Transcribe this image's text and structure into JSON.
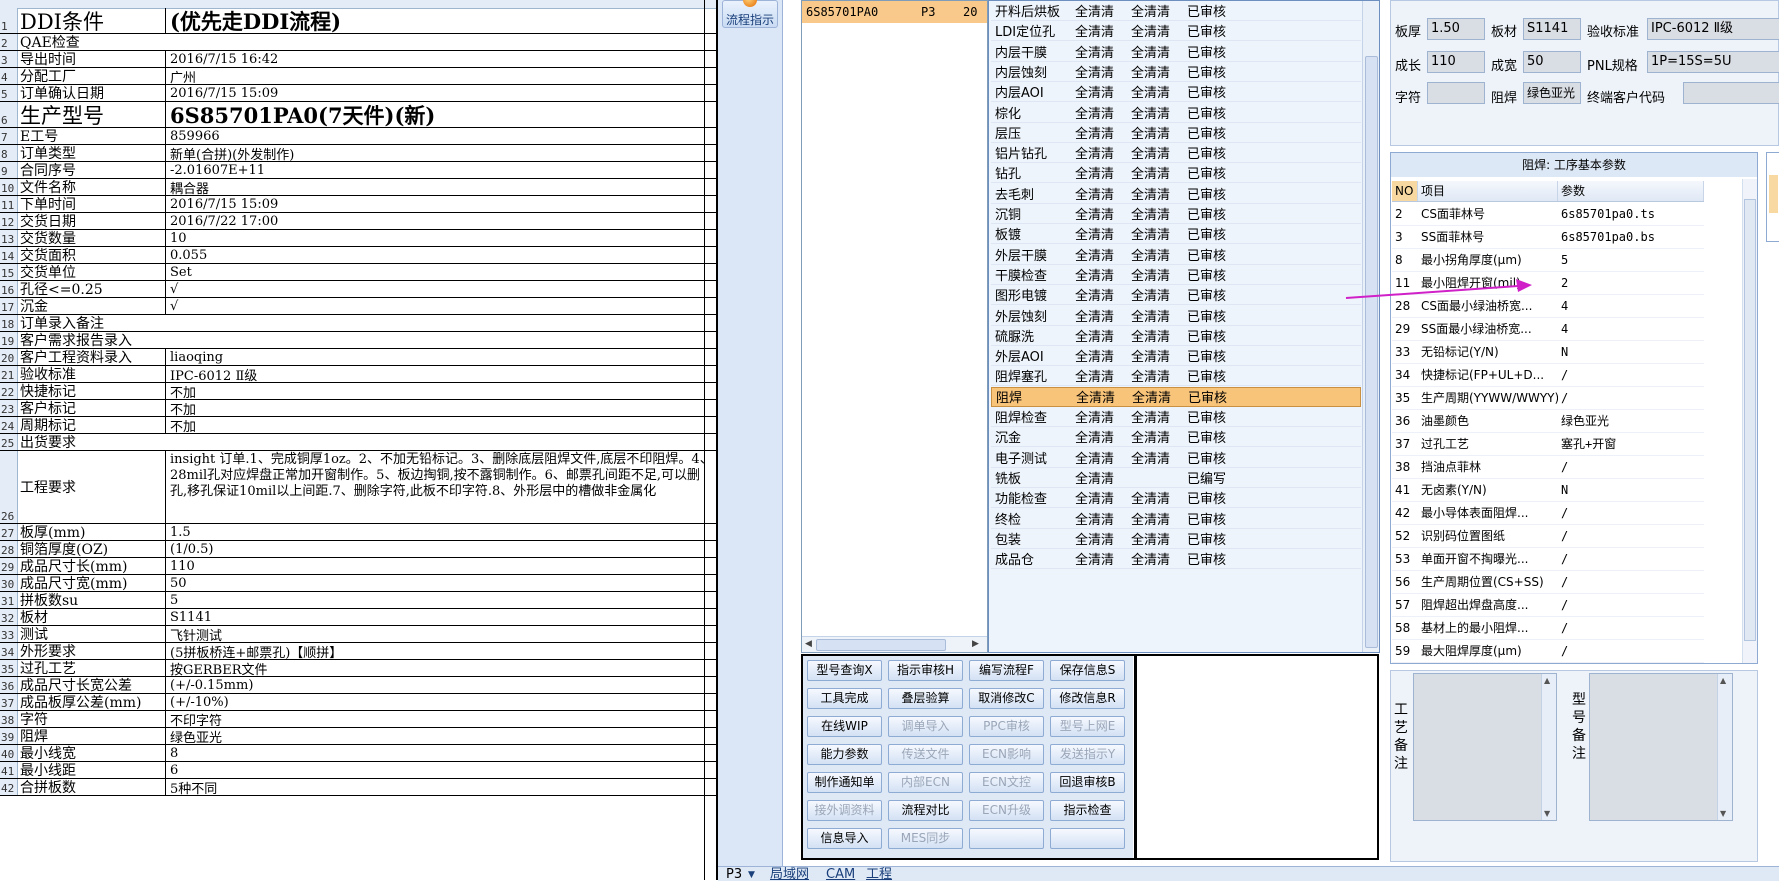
{
  "sheet": {
    "rows": [
      {
        "n": "1",
        "a": "DDI条件",
        "b": "(优先走DDI流程)",
        "big": true
      },
      {
        "n": "2",
        "ab": "QAE检查"
      },
      {
        "n": "3",
        "a": "导出时间",
        "b": "2016/7/15 16:42"
      },
      {
        "n": "4",
        "a": "分配工厂",
        "b": "广州"
      },
      {
        "n": "5",
        "a": "订单确认日期",
        "b": "2016/7/15 15:09"
      },
      {
        "n": "6",
        "a": "生产型号",
        "b": "6S85701PA0(7天件)(新)",
        "big": true
      },
      {
        "n": "7",
        "a": "E工号",
        "b": "859966"
      },
      {
        "n": "8",
        "a": "订单类型",
        "b": "新单(合拼)(外发制作)"
      },
      {
        "n": "9",
        "a": "合同序号",
        "b": "-2.01607E+11"
      },
      {
        "n": "10",
        "a": "文件名称",
        "b": "耦合器"
      },
      {
        "n": "11",
        "a": "下单时间",
        "b": "2016/7/15 15:09"
      },
      {
        "n": "12",
        "a": "交货日期",
        "b": "2016/7/22 17:00"
      },
      {
        "n": "13",
        "a": "交货数量",
        "b": "10"
      },
      {
        "n": "14",
        "a": "交货面积",
        "b": "0.055"
      },
      {
        "n": "15",
        "a": "交货单位",
        "b": "Set"
      },
      {
        "n": "16",
        "a": "孔径<=0.25",
        "b": "√"
      },
      {
        "n": "17",
        "a": "沉金",
        "b": "√"
      },
      {
        "n": "18",
        "ab": "订单录入备注"
      },
      {
        "n": "19",
        "ab": "客户需求报告录入"
      },
      {
        "n": "20",
        "a": "客户工程资料录入",
        "b": "liaoqing"
      },
      {
        "n": "21",
        "a": "验收标准",
        "b": "IPC-6012 Ⅱ级"
      },
      {
        "n": "22",
        "a": "快捷标记",
        "b": "不加"
      },
      {
        "n": "23",
        "a": "客户标记",
        "b": "不加"
      },
      {
        "n": "24",
        "a": "周期标记",
        "b": "不加"
      },
      {
        "n": "25",
        "ab": "出货要求"
      },
      {
        "n": "26",
        "a": "工程要求",
        "b": "insight 订单.1、完成铜厚1oz。2、不加无铅标记。3、删除底层阻焊文件,底层不印阻焊。4、28mil孔对应焊盘正常加开窗制作。5、板边掏铜,按不露铜制作。6、邮票孔间距不足,可以删孔,移孔保证10mil以上间距.7、删除字符,此板不印字符.8、外形层中的槽做非金属化",
        "wrap": true
      },
      {
        "n": "27",
        "a": "板厚(mm)",
        "b": "1.5"
      },
      {
        "n": "28",
        "a": "铜箔厚度(OZ)",
        "b": "(1/0.5)"
      },
      {
        "n": "29",
        "a": "成品尺寸长(mm)",
        "b": "110"
      },
      {
        "n": "30",
        "a": "成品尺寸宽(mm)",
        "b": "50"
      },
      {
        "n": "31",
        "a": "拼板数su",
        "b": "5"
      },
      {
        "n": "32",
        "a": "板材",
        "b": "S1141"
      },
      {
        "n": "33",
        "a": "测试",
        "b": "飞针测试"
      },
      {
        "n": "34",
        "a": "外形要求",
        "b": "(5拼板桥连+邮票孔)【顺拼】"
      },
      {
        "n": "35",
        "a": "过孔工艺",
        "b": "按GERBER文件"
      },
      {
        "n": "36",
        "a": "成品尺寸长宽公差",
        "b": "(+/-0.15mm)"
      },
      {
        "n": "37",
        "a": "成品板厚公差(mm)",
        "b": "(+/-10%)"
      },
      {
        "n": "38",
        "a": "字符",
        "b": "不印字符"
      },
      {
        "n": "39",
        "a": "阻焊",
        "b": "绿色亚光"
      },
      {
        "n": "40",
        "a": "最小线宽",
        "b": "8"
      },
      {
        "n": "41",
        "a": "最小线距",
        "b": "6"
      },
      {
        "n": "42",
        "a": "合拼板数",
        "b": "5种不同"
      }
    ]
  },
  "strip": {
    "flow_button": "流程指示"
  },
  "model_list": {
    "item": {
      "model": "6S85701PA0",
      "code": "P3",
      "num": "20"
    }
  },
  "process_table": {
    "rows": [
      {
        "name": "开料后烘板",
        "c1": "全清清",
        "c2": "全清清",
        "c3": "已审核"
      },
      {
        "name": "LDI定位孔",
        "c1": "全清清",
        "c2": "全清清",
        "c3": "已审核"
      },
      {
        "name": "内层干膜",
        "c1": "全清清",
        "c2": "全清清",
        "c3": "已审核"
      },
      {
        "name": "内层蚀刻",
        "c1": "全清清",
        "c2": "全清清",
        "c3": "已审核"
      },
      {
        "name": "内层AOI",
        "c1": "全清清",
        "c2": "全清清",
        "c3": "已审核"
      },
      {
        "name": "棕化",
        "c1": "全清清",
        "c2": "全清清",
        "c3": "已审核"
      },
      {
        "name": "层压",
        "c1": "全清清",
        "c2": "全清清",
        "c3": "已审核"
      },
      {
        "name": "铝片钻孔",
        "c1": "全清清",
        "c2": "全清清",
        "c3": "已审核"
      },
      {
        "name": "钻孔",
        "c1": "全清清",
        "c2": "全清清",
        "c3": "已审核"
      },
      {
        "name": "去毛刺",
        "c1": "全清清",
        "c2": "全清清",
        "c3": "已审核"
      },
      {
        "name": "沉铜",
        "c1": "全清清",
        "c2": "全清清",
        "c3": "已审核"
      },
      {
        "name": "板镀",
        "c1": "全清清",
        "c2": "全清清",
        "c3": "已审核"
      },
      {
        "name": "外层干膜",
        "c1": "全清清",
        "c2": "全清清",
        "c3": "已审核"
      },
      {
        "name": "干膜检查",
        "c1": "全清清",
        "c2": "全清清",
        "c3": "已审核"
      },
      {
        "name": "图形电镀",
        "c1": "全清清",
        "c2": "全清清",
        "c3": "已审核"
      },
      {
        "name": "外层蚀刻",
        "c1": "全清清",
        "c2": "全清清",
        "c3": "已审核"
      },
      {
        "name": "硫脲洗",
        "c1": "全清清",
        "c2": "全清清",
        "c3": "已审核"
      },
      {
        "name": "外层AOI",
        "c1": "全清清",
        "c2": "全清清",
        "c3": "已审核"
      },
      {
        "name": "阻焊塞孔",
        "c1": "全清清",
        "c2": "全清清",
        "c3": "已审核"
      },
      {
        "name": "阻焊",
        "c1": "全清清",
        "c2": "全清清",
        "c3": "已审核",
        "sel": true
      },
      {
        "name": "阻焊检查",
        "c1": "全清清",
        "c2": "全清清",
        "c3": "已审核"
      },
      {
        "name": "沉金",
        "c1": "全清清",
        "c2": "全清清",
        "c3": "已审核"
      },
      {
        "name": "电子测试",
        "c1": "全清清",
        "c2": "全清清",
        "c3": "已审核"
      },
      {
        "name": "铣板",
        "c1": "全清清",
        "c2": "",
        "c3": "已编写"
      },
      {
        "name": "功能检查",
        "c1": "全清清",
        "c2": "全清清",
        "c3": "已审核"
      },
      {
        "name": "终检",
        "c1": "全清清",
        "c2": "全清清",
        "c3": "已审核"
      },
      {
        "name": "包装",
        "c1": "全清清",
        "c2": "全清清",
        "c3": "已审核"
      },
      {
        "name": "成品仓",
        "c1": "全清清",
        "c2": "全清清",
        "c3": "已审核"
      }
    ]
  },
  "buttons": [
    {
      "label": "型号查询Ⅹ",
      "dis": false
    },
    {
      "label": "指示审核H",
      "dis": false
    },
    {
      "label": "编写流程F",
      "dis": false
    },
    {
      "label": "保存信息S",
      "dis": false
    },
    {
      "label": "工具完成",
      "dis": false
    },
    {
      "label": "叠层验算",
      "dis": false
    },
    {
      "label": "取消修改C",
      "dis": false
    },
    {
      "label": "修改信息R",
      "dis": false
    },
    {
      "label": "在线WIP",
      "dis": false
    },
    {
      "label": "调单导入",
      "dis": true
    },
    {
      "label": "PPC审核",
      "dis": true
    },
    {
      "label": "型号上网E",
      "dis": true
    },
    {
      "label": "能力参数",
      "dis": false
    },
    {
      "label": "传送文件",
      "dis": true
    },
    {
      "label": "ECN影响",
      "dis": true
    },
    {
      "label": "发送指示Y",
      "dis": true
    },
    {
      "label": "制作通知单",
      "dis": false
    },
    {
      "label": "内部ECN",
      "dis": true
    },
    {
      "label": "ECN文控",
      "dis": true
    },
    {
      "label": "回退审核B",
      "dis": false
    },
    {
      "label": "接外调资料",
      "dis": true
    },
    {
      "label": "流程对比",
      "dis": false
    },
    {
      "label": "ECN升级",
      "dis": true
    },
    {
      "label": "指示检查",
      "dis": false
    },
    {
      "label": "信息导入",
      "dis": false
    },
    {
      "label": "MES同步",
      "dis": true
    },
    {
      "label": "",
      "dis": false
    },
    {
      "label": "",
      "dis": false
    }
  ],
  "info": {
    "thickness_label": "板厚",
    "thickness": "1.50",
    "material_label": "板材",
    "material": "S1141",
    "standard_label": "验收标准",
    "standard": "IPC-6012 Ⅱ级",
    "length_label": "成长",
    "length": "110",
    "width_label": "成宽",
    "width": "50",
    "pnl_label": "PNL规格",
    "pnl": "1P=15S=5U",
    "char_label": "字符",
    "char": "",
    "mask_label": "阻焊",
    "mask": "绿色亚光",
    "cust_label": "终端客户代码",
    "cust": ""
  },
  "params": {
    "title": "阻焊: 工序基本参数",
    "head_no": "NO",
    "head_item": "项目",
    "head_val": "参数",
    "rows": [
      {
        "no": "2",
        "item": "CS面菲林号",
        "val": "6s85701pa0.ts"
      },
      {
        "no": "3",
        "item": "SS面菲林号",
        "val": "6s85701pa0.bs"
      },
      {
        "no": "8",
        "item": "最小拐角厚度(μm)",
        "val": "5"
      },
      {
        "no": "11",
        "item": "最小阻焊开窗(mil)",
        "val": "2"
      },
      {
        "no": "28",
        "item": "CS面最小绿油桥宽...",
        "val": "4"
      },
      {
        "no": "29",
        "item": "SS面最小绿油桥宽...",
        "val": "4"
      },
      {
        "no": "33",
        "item": "无铅标记(Y/N)",
        "val": "N"
      },
      {
        "no": "34",
        "item": "快捷标记(FP+UL+D...",
        "val": "/"
      },
      {
        "no": "35",
        "item": "生产周期(YYWW/WWYY)",
        "val": "/"
      },
      {
        "no": "36",
        "item": "油墨颜色",
        "val": "绿色亚光"
      },
      {
        "no": "37",
        "item": "过孔工艺",
        "val": "塞孔+开窗"
      },
      {
        "no": "38",
        "item": "挡油点菲林",
        "val": "/"
      },
      {
        "no": "41",
        "item": "无卤素(Y/N)",
        "val": "N"
      },
      {
        "no": "42",
        "item": "最小导体表面阻焊...",
        "val": "/"
      },
      {
        "no": "52",
        "item": "识别码位置图纸",
        "val": "/"
      },
      {
        "no": "53",
        "item": "单面开窗不掏曝光...",
        "val": "/"
      },
      {
        "no": "56",
        "item": "生产周期位置(CS+SS)",
        "val": "/"
      },
      {
        "no": "57",
        "item": "阻焊超出焊盘高度...",
        "val": "/"
      },
      {
        "no": "58",
        "item": "基材上的最小阻焊...",
        "val": "/"
      },
      {
        "no": "59",
        "item": "最大阻焊厚度(μm)",
        "val": "/"
      }
    ]
  },
  "remarks": {
    "process_label": "工艺备注",
    "model_label": "型号备注"
  },
  "bottom_tabs": [
    "P3",
    "局域网",
    "CAM",
    "工程"
  ],
  "colors": {
    "accent": "#f8c47a",
    "arrow": "#d020c8"
  }
}
